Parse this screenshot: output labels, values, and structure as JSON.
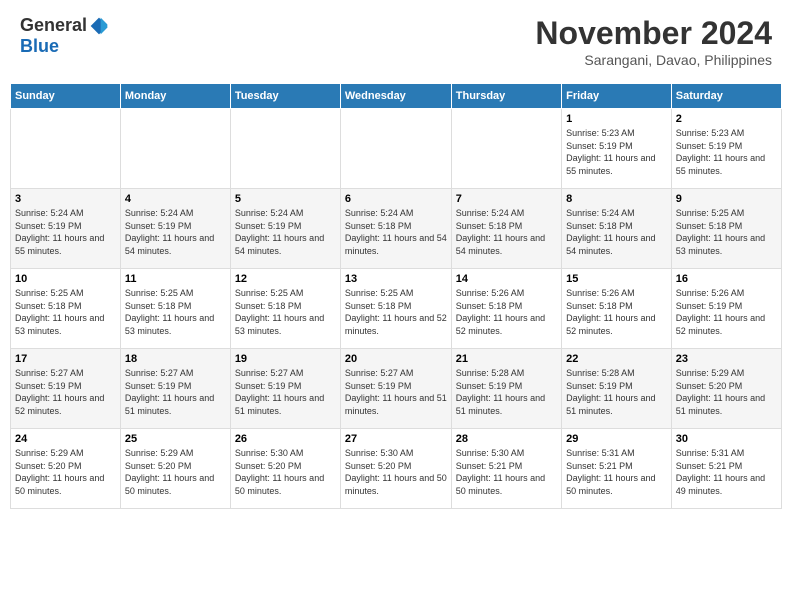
{
  "header": {
    "logo_general": "General",
    "logo_blue": "Blue",
    "month_title": "November 2024",
    "location": "Sarangani, Davao, Philippines"
  },
  "calendar": {
    "days_of_week": [
      "Sunday",
      "Monday",
      "Tuesday",
      "Wednesday",
      "Thursday",
      "Friday",
      "Saturday"
    ],
    "weeks": [
      [
        {
          "day": "",
          "info": ""
        },
        {
          "day": "",
          "info": ""
        },
        {
          "day": "",
          "info": ""
        },
        {
          "day": "",
          "info": ""
        },
        {
          "day": "",
          "info": ""
        },
        {
          "day": "1",
          "info": "Sunrise: 5:23 AM\nSunset: 5:19 PM\nDaylight: 11 hours and 55 minutes."
        },
        {
          "day": "2",
          "info": "Sunrise: 5:23 AM\nSunset: 5:19 PM\nDaylight: 11 hours and 55 minutes."
        }
      ],
      [
        {
          "day": "3",
          "info": "Sunrise: 5:24 AM\nSunset: 5:19 PM\nDaylight: 11 hours and 55 minutes."
        },
        {
          "day": "4",
          "info": "Sunrise: 5:24 AM\nSunset: 5:19 PM\nDaylight: 11 hours and 54 minutes."
        },
        {
          "day": "5",
          "info": "Sunrise: 5:24 AM\nSunset: 5:19 PM\nDaylight: 11 hours and 54 minutes."
        },
        {
          "day": "6",
          "info": "Sunrise: 5:24 AM\nSunset: 5:18 PM\nDaylight: 11 hours and 54 minutes."
        },
        {
          "day": "7",
          "info": "Sunrise: 5:24 AM\nSunset: 5:18 PM\nDaylight: 11 hours and 54 minutes."
        },
        {
          "day": "8",
          "info": "Sunrise: 5:24 AM\nSunset: 5:18 PM\nDaylight: 11 hours and 54 minutes."
        },
        {
          "day": "9",
          "info": "Sunrise: 5:25 AM\nSunset: 5:18 PM\nDaylight: 11 hours and 53 minutes."
        }
      ],
      [
        {
          "day": "10",
          "info": "Sunrise: 5:25 AM\nSunset: 5:18 PM\nDaylight: 11 hours and 53 minutes."
        },
        {
          "day": "11",
          "info": "Sunrise: 5:25 AM\nSunset: 5:18 PM\nDaylight: 11 hours and 53 minutes."
        },
        {
          "day": "12",
          "info": "Sunrise: 5:25 AM\nSunset: 5:18 PM\nDaylight: 11 hours and 53 minutes."
        },
        {
          "day": "13",
          "info": "Sunrise: 5:25 AM\nSunset: 5:18 PM\nDaylight: 11 hours and 52 minutes."
        },
        {
          "day": "14",
          "info": "Sunrise: 5:26 AM\nSunset: 5:18 PM\nDaylight: 11 hours and 52 minutes."
        },
        {
          "day": "15",
          "info": "Sunrise: 5:26 AM\nSunset: 5:18 PM\nDaylight: 11 hours and 52 minutes."
        },
        {
          "day": "16",
          "info": "Sunrise: 5:26 AM\nSunset: 5:19 PM\nDaylight: 11 hours and 52 minutes."
        }
      ],
      [
        {
          "day": "17",
          "info": "Sunrise: 5:27 AM\nSunset: 5:19 PM\nDaylight: 11 hours and 52 minutes."
        },
        {
          "day": "18",
          "info": "Sunrise: 5:27 AM\nSunset: 5:19 PM\nDaylight: 11 hours and 51 minutes."
        },
        {
          "day": "19",
          "info": "Sunrise: 5:27 AM\nSunset: 5:19 PM\nDaylight: 11 hours and 51 minutes."
        },
        {
          "day": "20",
          "info": "Sunrise: 5:27 AM\nSunset: 5:19 PM\nDaylight: 11 hours and 51 minutes."
        },
        {
          "day": "21",
          "info": "Sunrise: 5:28 AM\nSunset: 5:19 PM\nDaylight: 11 hours and 51 minutes."
        },
        {
          "day": "22",
          "info": "Sunrise: 5:28 AM\nSunset: 5:19 PM\nDaylight: 11 hours and 51 minutes."
        },
        {
          "day": "23",
          "info": "Sunrise: 5:29 AM\nSunset: 5:20 PM\nDaylight: 11 hours and 51 minutes."
        }
      ],
      [
        {
          "day": "24",
          "info": "Sunrise: 5:29 AM\nSunset: 5:20 PM\nDaylight: 11 hours and 50 minutes."
        },
        {
          "day": "25",
          "info": "Sunrise: 5:29 AM\nSunset: 5:20 PM\nDaylight: 11 hours and 50 minutes."
        },
        {
          "day": "26",
          "info": "Sunrise: 5:30 AM\nSunset: 5:20 PM\nDaylight: 11 hours and 50 minutes."
        },
        {
          "day": "27",
          "info": "Sunrise: 5:30 AM\nSunset: 5:20 PM\nDaylight: 11 hours and 50 minutes."
        },
        {
          "day": "28",
          "info": "Sunrise: 5:30 AM\nSunset: 5:21 PM\nDaylight: 11 hours and 50 minutes."
        },
        {
          "day": "29",
          "info": "Sunrise: 5:31 AM\nSunset: 5:21 PM\nDaylight: 11 hours and 50 minutes."
        },
        {
          "day": "30",
          "info": "Sunrise: 5:31 AM\nSunset: 5:21 PM\nDaylight: 11 hours and 49 minutes."
        }
      ]
    ]
  }
}
